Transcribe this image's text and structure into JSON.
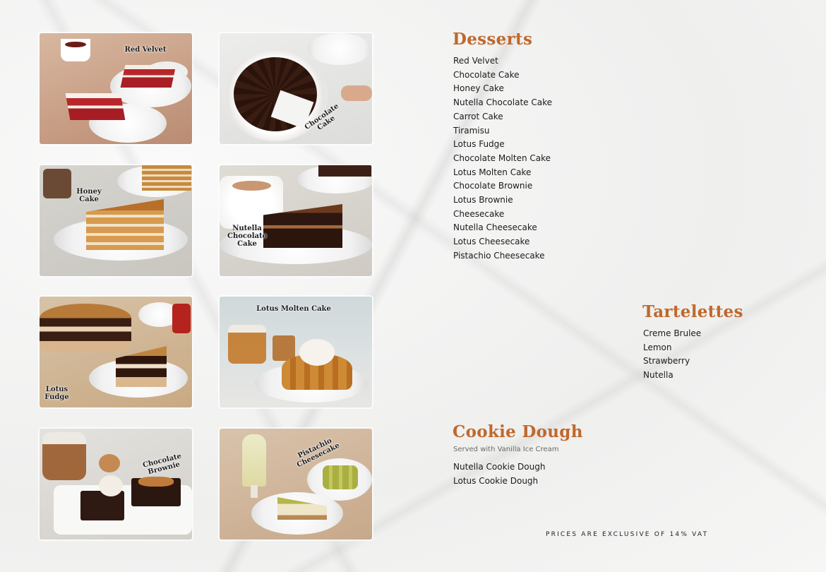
{
  "photos": [
    {
      "name": "red-velvet",
      "label": "Red Velvet"
    },
    {
      "name": "chocolate-cake",
      "label": "Chocolate Cake"
    },
    {
      "name": "honey-cake",
      "label": "Honey Cake"
    },
    {
      "name": "nutella-chocolate-cake",
      "label": "Nutella Chocolate Cake"
    },
    {
      "name": "lotus-fudge",
      "label": "Lotus Fudge"
    },
    {
      "name": "lotus-molten-cake",
      "label": "Lotus Molten Cake"
    },
    {
      "name": "chocolate-brownie",
      "label": "Chocolate Brownie"
    },
    {
      "name": "pistachio-cheesecake",
      "label": "Pistachio Cheesecake"
    }
  ],
  "desserts": {
    "title": "Desserts",
    "items": [
      "Red Velvet",
      "Chocolate Cake",
      "Honey Cake",
      "Nutella Chocolate Cake",
      "Carrot Cake",
      "Tiramisu",
      "Lotus Fudge",
      "Chocolate Molten Cake",
      "Lotus Molten Cake",
      "Chocolate Brownie",
      "Lotus Brownie",
      "Cheesecake",
      "Nutella Cheesecake",
      "Lotus Cheesecake",
      "Pistachio Cheesecake"
    ]
  },
  "tartelettes": {
    "title": "Tartelettes",
    "items": [
      "Creme Brulee",
      "Lemon",
      "Strawberry",
      "Nutella"
    ]
  },
  "cookie_dough": {
    "title": "Cookie Dough",
    "subtitle": "Served with Vanilla Ice Cream",
    "items": [
      "Nutella Cookie Dough",
      "Lotus Cookie Dough"
    ]
  },
  "footer": {
    "vat_note": "PRICES ARE EXCLUSIVE OF 14% VAT"
  },
  "colors": {
    "accent": "#c0682d",
    "text": "#1b1b1b"
  }
}
